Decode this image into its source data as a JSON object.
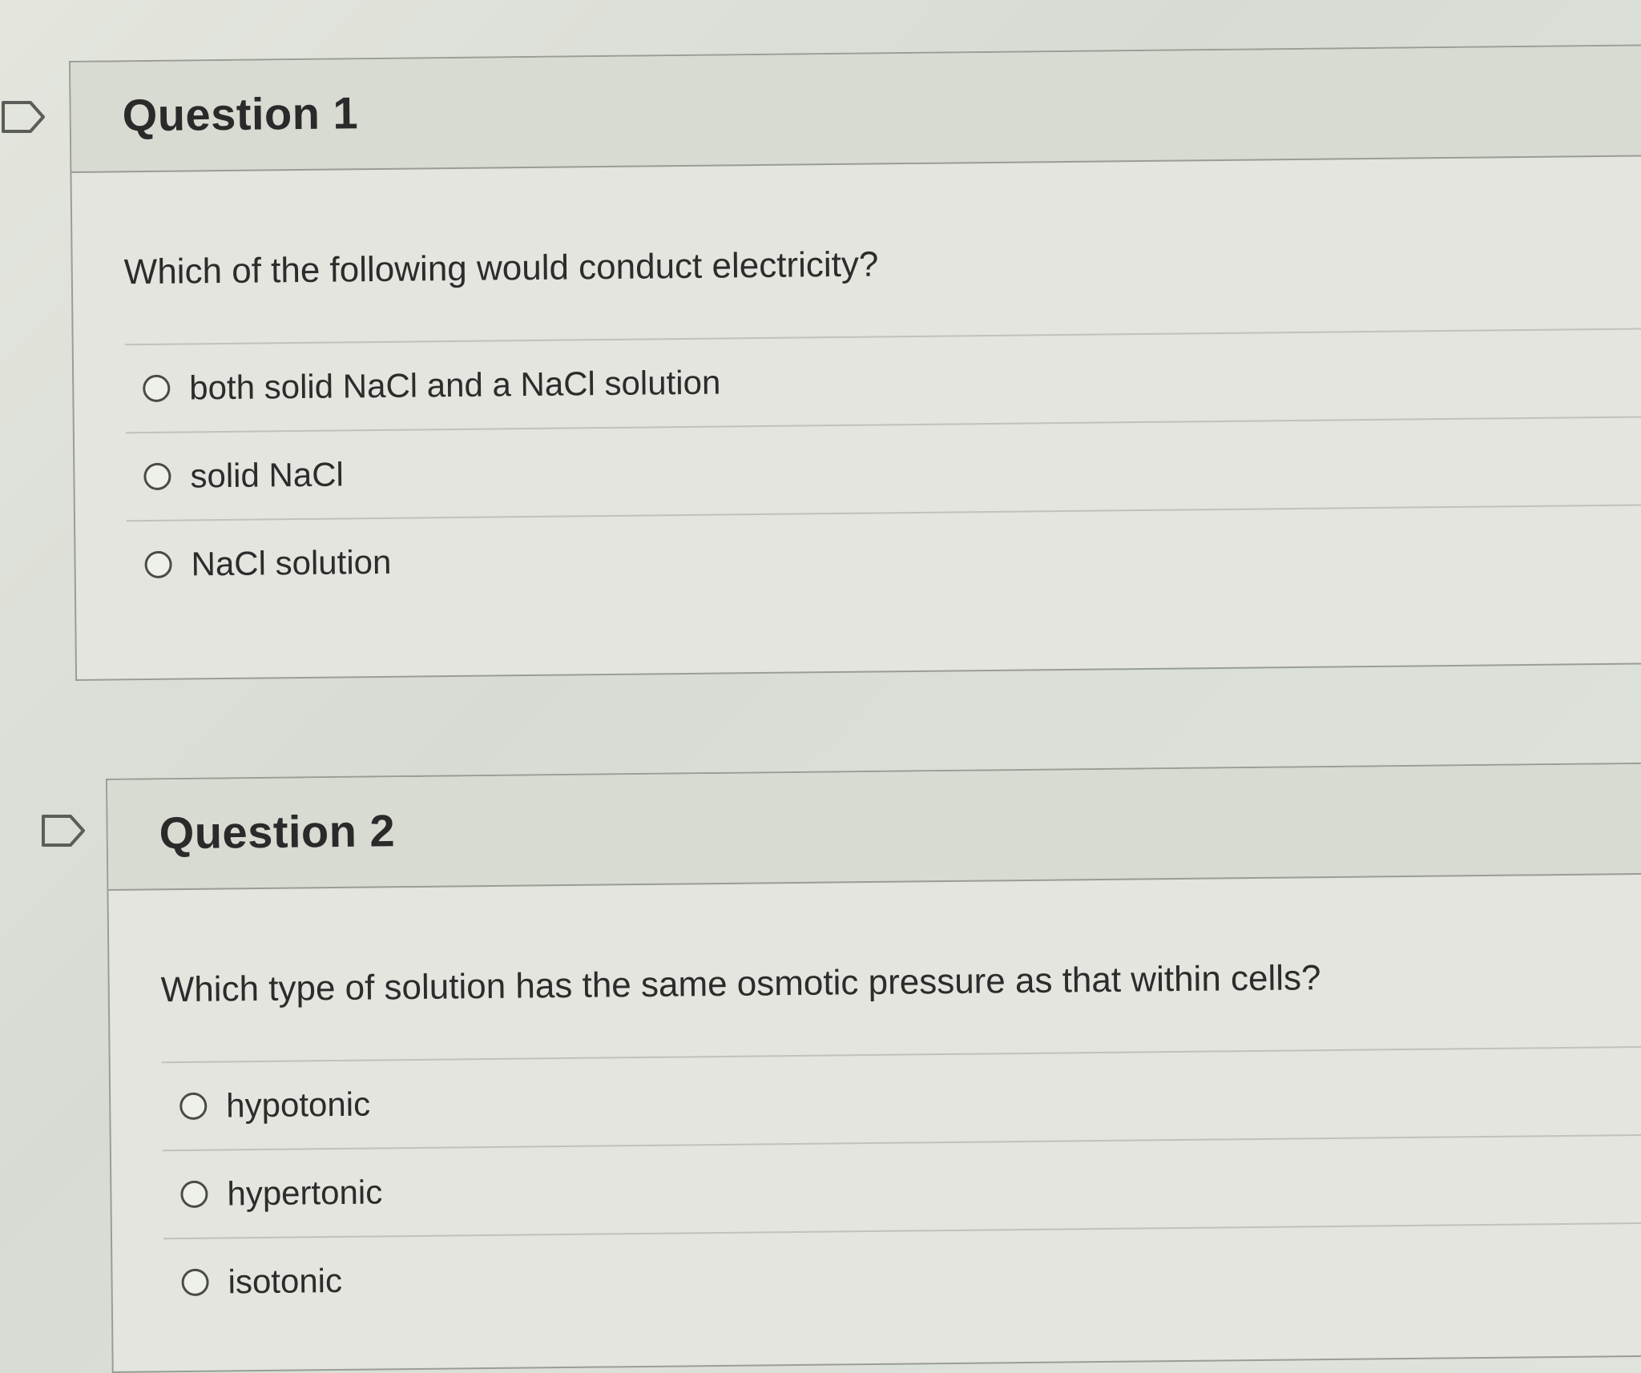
{
  "questions": [
    {
      "title": "Question 1",
      "text": "Which of the following would conduct electricity?",
      "options": [
        "both solid NaCl and a NaCl solution",
        "solid NaCl",
        "NaCl solution"
      ]
    },
    {
      "title": "Question 2",
      "text": "Which type of solution has the same osmotic pressure as that within cells?",
      "options": [
        "hypotonic",
        "hypertonic",
        "isotonic"
      ]
    }
  ],
  "icons": {
    "bookmark": "bookmark-flag-icon"
  },
  "colors": {
    "card_background": "#e3e5de",
    "border": "#9a9d97",
    "text": "#2b2b2b"
  }
}
